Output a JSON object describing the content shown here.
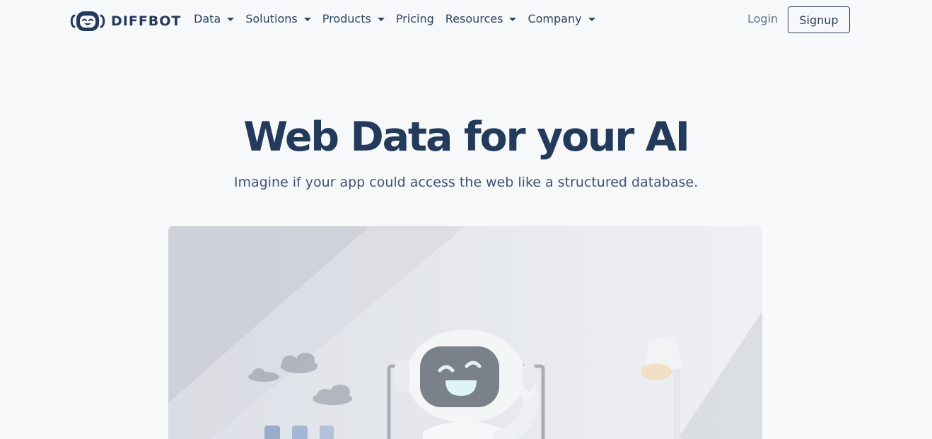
{
  "brand": {
    "name": "DIFFBOT",
    "logo_icon": "diffbot-robot-logo-icon"
  },
  "nav": {
    "items": [
      {
        "label": "Data",
        "has_dropdown": true
      },
      {
        "label": "Solutions",
        "has_dropdown": true
      },
      {
        "label": "Products",
        "has_dropdown": true
      },
      {
        "label": "Pricing",
        "has_dropdown": false
      },
      {
        "label": "Resources",
        "has_dropdown": true
      },
      {
        "label": "Company",
        "has_dropdown": true
      }
    ],
    "login_label": "Login",
    "signup_label": "Signup"
  },
  "hero": {
    "title": "Web Data for your AI",
    "subtitle": "Imagine if your app could access the web like a structured database.",
    "image_subject": "smiling-robot-illustration"
  },
  "colors": {
    "background": "#f7f8fa",
    "text_primary": "#233a5a",
    "text_nav": "#2e4566",
    "text_muted": "#5f7490"
  }
}
